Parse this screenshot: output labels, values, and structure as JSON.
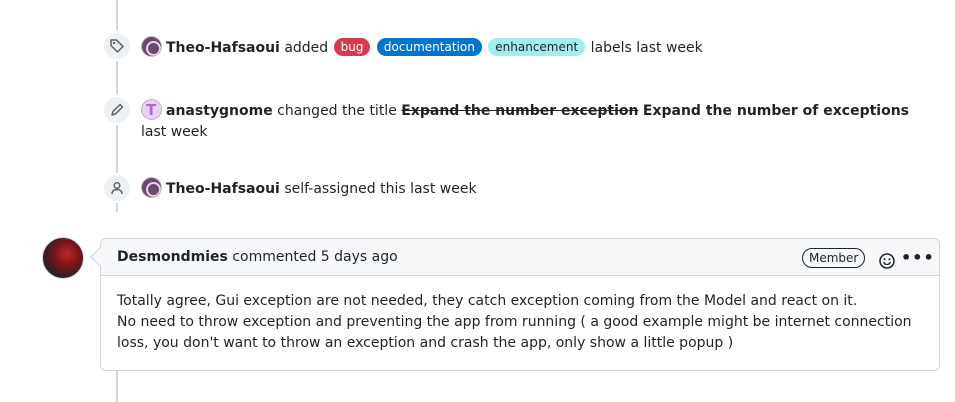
{
  "events": [
    {
      "icon": "tag-icon",
      "author": "Theo-Hafsaoui",
      "action": "added",
      "labels": [
        {
          "name": "bug",
          "bg": "#d73a4a",
          "fg": "#ffffff"
        },
        {
          "name": "documentation",
          "bg": "#0075ca",
          "fg": "#ffffff"
        },
        {
          "name": "enhancement",
          "bg": "#a2eeef",
          "fg": "#1f2328"
        }
      ],
      "suffix": "labels last week"
    },
    {
      "icon": "pencil-icon",
      "author": "anastygnome",
      "action": "changed the title",
      "old_title": "Expand the number exception",
      "new_title": "Expand the number of exceptions",
      "suffix": "last week"
    },
    {
      "icon": "person-icon",
      "author": "Theo-Hafsaoui",
      "action": "self-assigned this last week"
    }
  ],
  "comment": {
    "author": "Desmondmies",
    "meta": "commented 5 days ago",
    "badge": "Member",
    "more": "•••",
    "lines": [
      "Totally agree, Gui exception are not needed, they catch exception coming from the Model and react on it.",
      "No need to throw exception and preventing the app from running ( a good example might be internet connection",
      "loss, you don't want to throw an exception and crash the app, only show a little popup )"
    ]
  }
}
